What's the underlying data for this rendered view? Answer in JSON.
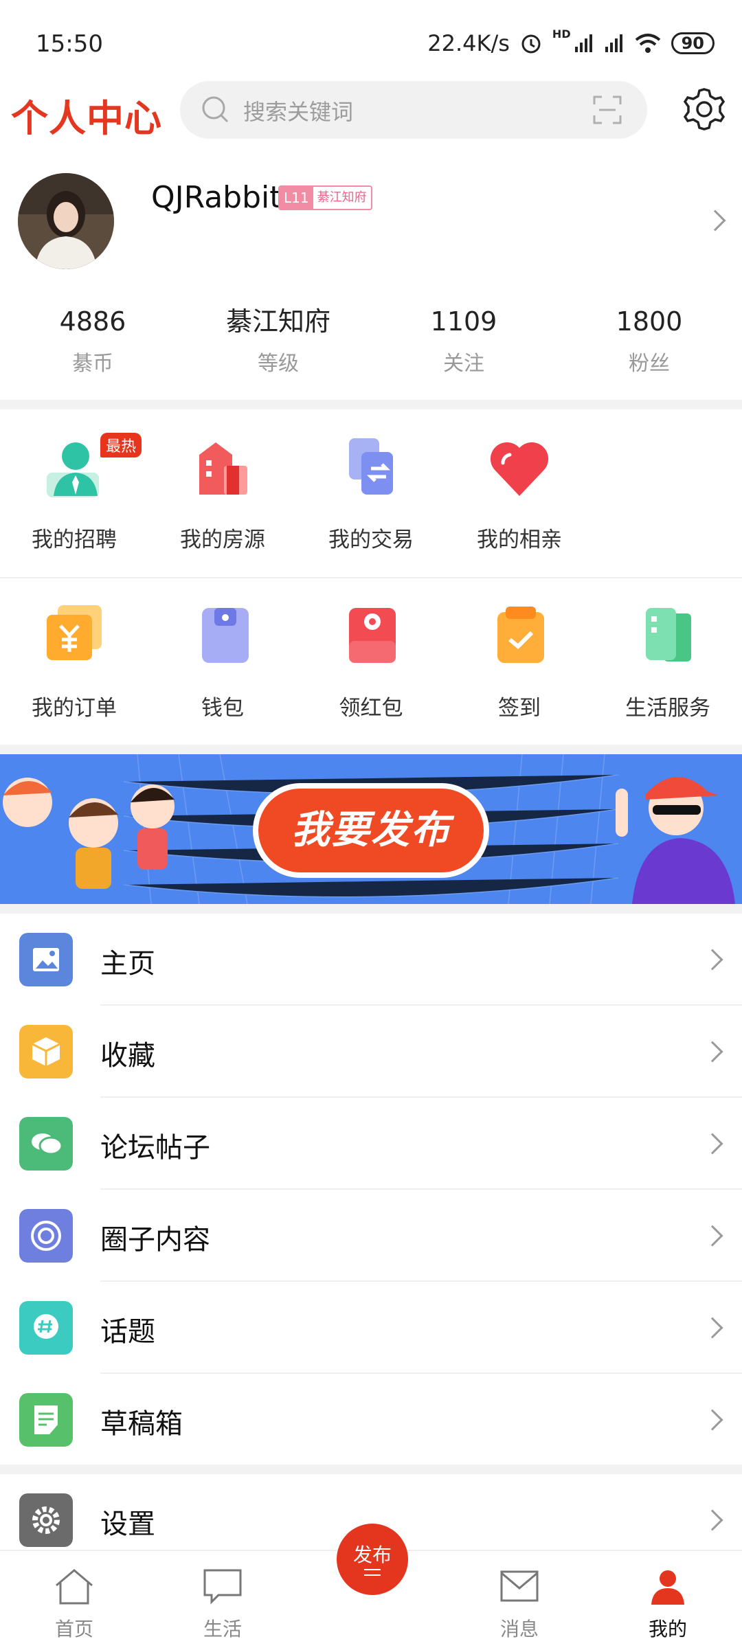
{
  "status_bar": {
    "time": "15:50",
    "net_speed": "22.4K/s",
    "network": "HD",
    "battery": "90"
  },
  "header": {
    "title": "个人中心",
    "search_placeholder": "搜索关键词"
  },
  "profile": {
    "username": "QJRabbit",
    "level": "L11",
    "level_title": "綦江知府"
  },
  "stats": [
    {
      "value": "4886",
      "label": "綦币"
    },
    {
      "value": "綦江知府",
      "label": "等级"
    },
    {
      "value": "1109",
      "label": "关注"
    },
    {
      "value": "1800",
      "label": "粉丝"
    }
  ],
  "grid_row1": [
    {
      "label": "我的招聘",
      "icon": "recruit-icon"
    },
    {
      "label": "我的房源",
      "icon": "house-icon"
    },
    {
      "label": "我的交易",
      "icon": "trade-icon"
    },
    {
      "label": "我的相亲",
      "icon": "heart-icon"
    }
  ],
  "hot_badge": "最热",
  "grid_row2": [
    {
      "label": "我的订单",
      "icon": "order-icon"
    },
    {
      "label": "钱包",
      "icon": "wallet-icon"
    },
    {
      "label": "领红包",
      "icon": "red-packet-icon"
    },
    {
      "label": "签到",
      "icon": "checkin-icon"
    },
    {
      "label": "生活服务",
      "icon": "life-service-icon"
    }
  ],
  "banner": {
    "button_label": "我要发布"
  },
  "menu": [
    {
      "label": "主页",
      "icon": "image-icon",
      "color": "#5b86db"
    },
    {
      "label": "收藏",
      "icon": "box-icon",
      "color": "#f9b73a"
    },
    {
      "label": "论坛帖子",
      "icon": "chat-icon",
      "color": "#4cba78"
    },
    {
      "label": "圈子内容",
      "icon": "circle-icon",
      "color": "#6f7fe0"
    },
    {
      "label": "话题",
      "icon": "hashtag-icon",
      "color": "#3ccbc0"
    },
    {
      "label": "草稿箱",
      "icon": "draft-icon",
      "color": "#56c06a"
    }
  ],
  "settings": {
    "label": "设置",
    "icon": "gear-icon",
    "color": "#6b6b6b"
  },
  "bottom_nav": {
    "tabs": [
      {
        "label": "首页",
        "icon": "home-icon"
      },
      {
        "label": "生活",
        "icon": "chat-bubble-icon"
      },
      {
        "label": "消息",
        "icon": "mail-icon"
      },
      {
        "label": "我的",
        "icon": "user-icon"
      }
    ],
    "publish_label": "发布",
    "active_color": "#e4351e"
  }
}
